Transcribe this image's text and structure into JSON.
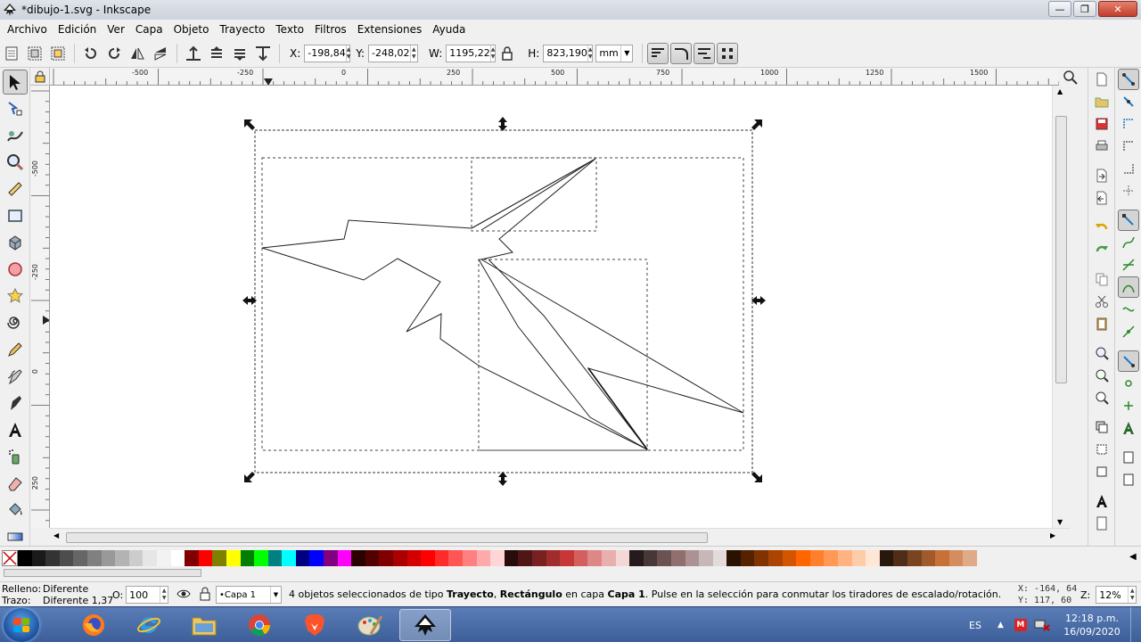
{
  "window": {
    "title": "*dibujo-1.svg - Inkscape"
  },
  "menu": {
    "items": [
      "Archivo",
      "Edición",
      "Ver",
      "Capa",
      "Objeto",
      "Trayecto",
      "Texto",
      "Filtros",
      "Extensiones",
      "Ayuda"
    ]
  },
  "toolbar": {
    "x_label": "X:",
    "x_value": "-198,84",
    "y_label": "Y:",
    "y_value": "-248,02",
    "w_label": "W:",
    "w_value": "1195,22",
    "h_label": "H:",
    "h_value": "823,190",
    "unit": "mm"
  },
  "ruler": {
    "h_labels": [
      "-500",
      "-250",
      "0",
      "250",
      "500",
      "750",
      "1000",
      "1250",
      "1500"
    ],
    "v_labels": [
      "-500",
      "-250",
      "0",
      "250"
    ]
  },
  "palette": {
    "colors": [
      "#000000",
      "#1a1a1a",
      "#333333",
      "#4d4d4d",
      "#666666",
      "#808080",
      "#999999",
      "#b3b3b3",
      "#cccccc",
      "#e6e6e6",
      "#f2f2f2",
      "#ffffff",
      "#800000",
      "#ff0000",
      "#808000",
      "#ffff00",
      "#008000",
      "#00ff00",
      "#008080",
      "#00ffff",
      "#000080",
      "#0000ff",
      "#800080",
      "#ff00ff",
      "#2b0000",
      "#550000",
      "#800000",
      "#aa0000",
      "#d40000",
      "#ff0000",
      "#ff2a2a",
      "#ff5555",
      "#ff8080",
      "#ffaaaa",
      "#ffd5d5",
      "#280b0b",
      "#501616",
      "#782121",
      "#a02c2c",
      "#c83737",
      "#d35f5f",
      "#de8787",
      "#e9afaf",
      "#f4d7d7",
      "#241c1c",
      "#483737",
      "#6c5353",
      "#916f6f",
      "#ac9393",
      "#c8b7b7",
      "#e3dbdb",
      "#2b1100",
      "#552200",
      "#803300",
      "#aa4400",
      "#d45500",
      "#ff6600",
      "#ff7f2a",
      "#ff9955",
      "#ffb380",
      "#ffccaa",
      "#ffe6d5",
      "#28170b",
      "#502d16",
      "#784421",
      "#a05a2c",
      "#c87137",
      "#d38d5f",
      "#deaa87"
    ]
  },
  "status": {
    "fill_label": "Relleno:",
    "fill_value": "Diferente",
    "stroke_label": "Trazo:",
    "stroke_value": "Diferente 1,37",
    "opacity_label": "O:",
    "opacity_value": "100",
    "layer": "•Capa 1",
    "msg_a": "4 objetos seleccionados de tipo ",
    "msg_b": "Trayecto",
    "msg_c": ", ",
    "msg_d": "Rectángulo",
    "msg_e": " en capa ",
    "msg_f": "Capa 1",
    "msg_g": ". Pulse en la selección para conmutar los tiradores de escalado/rotación.",
    "x_coord": "X: -164, 64",
    "y_coord": "Y:  117, 60",
    "zoom_label": "Z:",
    "zoom_value": "12%"
  },
  "taskbar": {
    "language": "ES",
    "time": "12:18 p.m.",
    "date": "16/09/2020"
  }
}
